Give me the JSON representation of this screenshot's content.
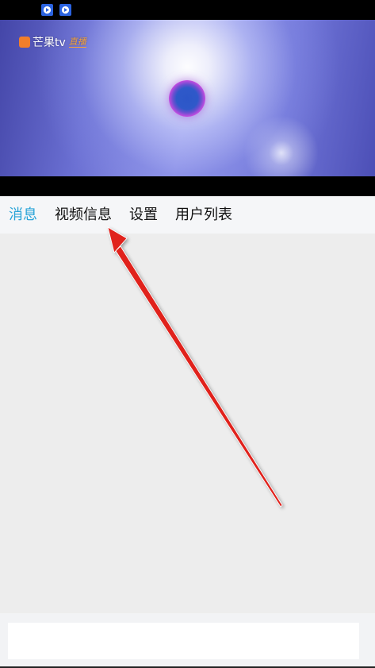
{
  "status_bar": {
    "icons": [
      "video-app-icon",
      "video-app-icon"
    ]
  },
  "video": {
    "logo_text": "芒果tv",
    "logo_badge": "直播",
    "brand_color": "#f27e2a"
  },
  "tabs": [
    {
      "label": "消息",
      "active": true
    },
    {
      "label": "视频信息",
      "active": false
    },
    {
      "label": "设置",
      "active": false
    },
    {
      "label": "用户列表",
      "active": false
    }
  ],
  "colors": {
    "active_tab": "#29a4d8",
    "tab_text": "#111111",
    "content_bg": "#ededed",
    "arrow": "#e0201b"
  },
  "message_input": {
    "value": "",
    "placeholder": ""
  }
}
